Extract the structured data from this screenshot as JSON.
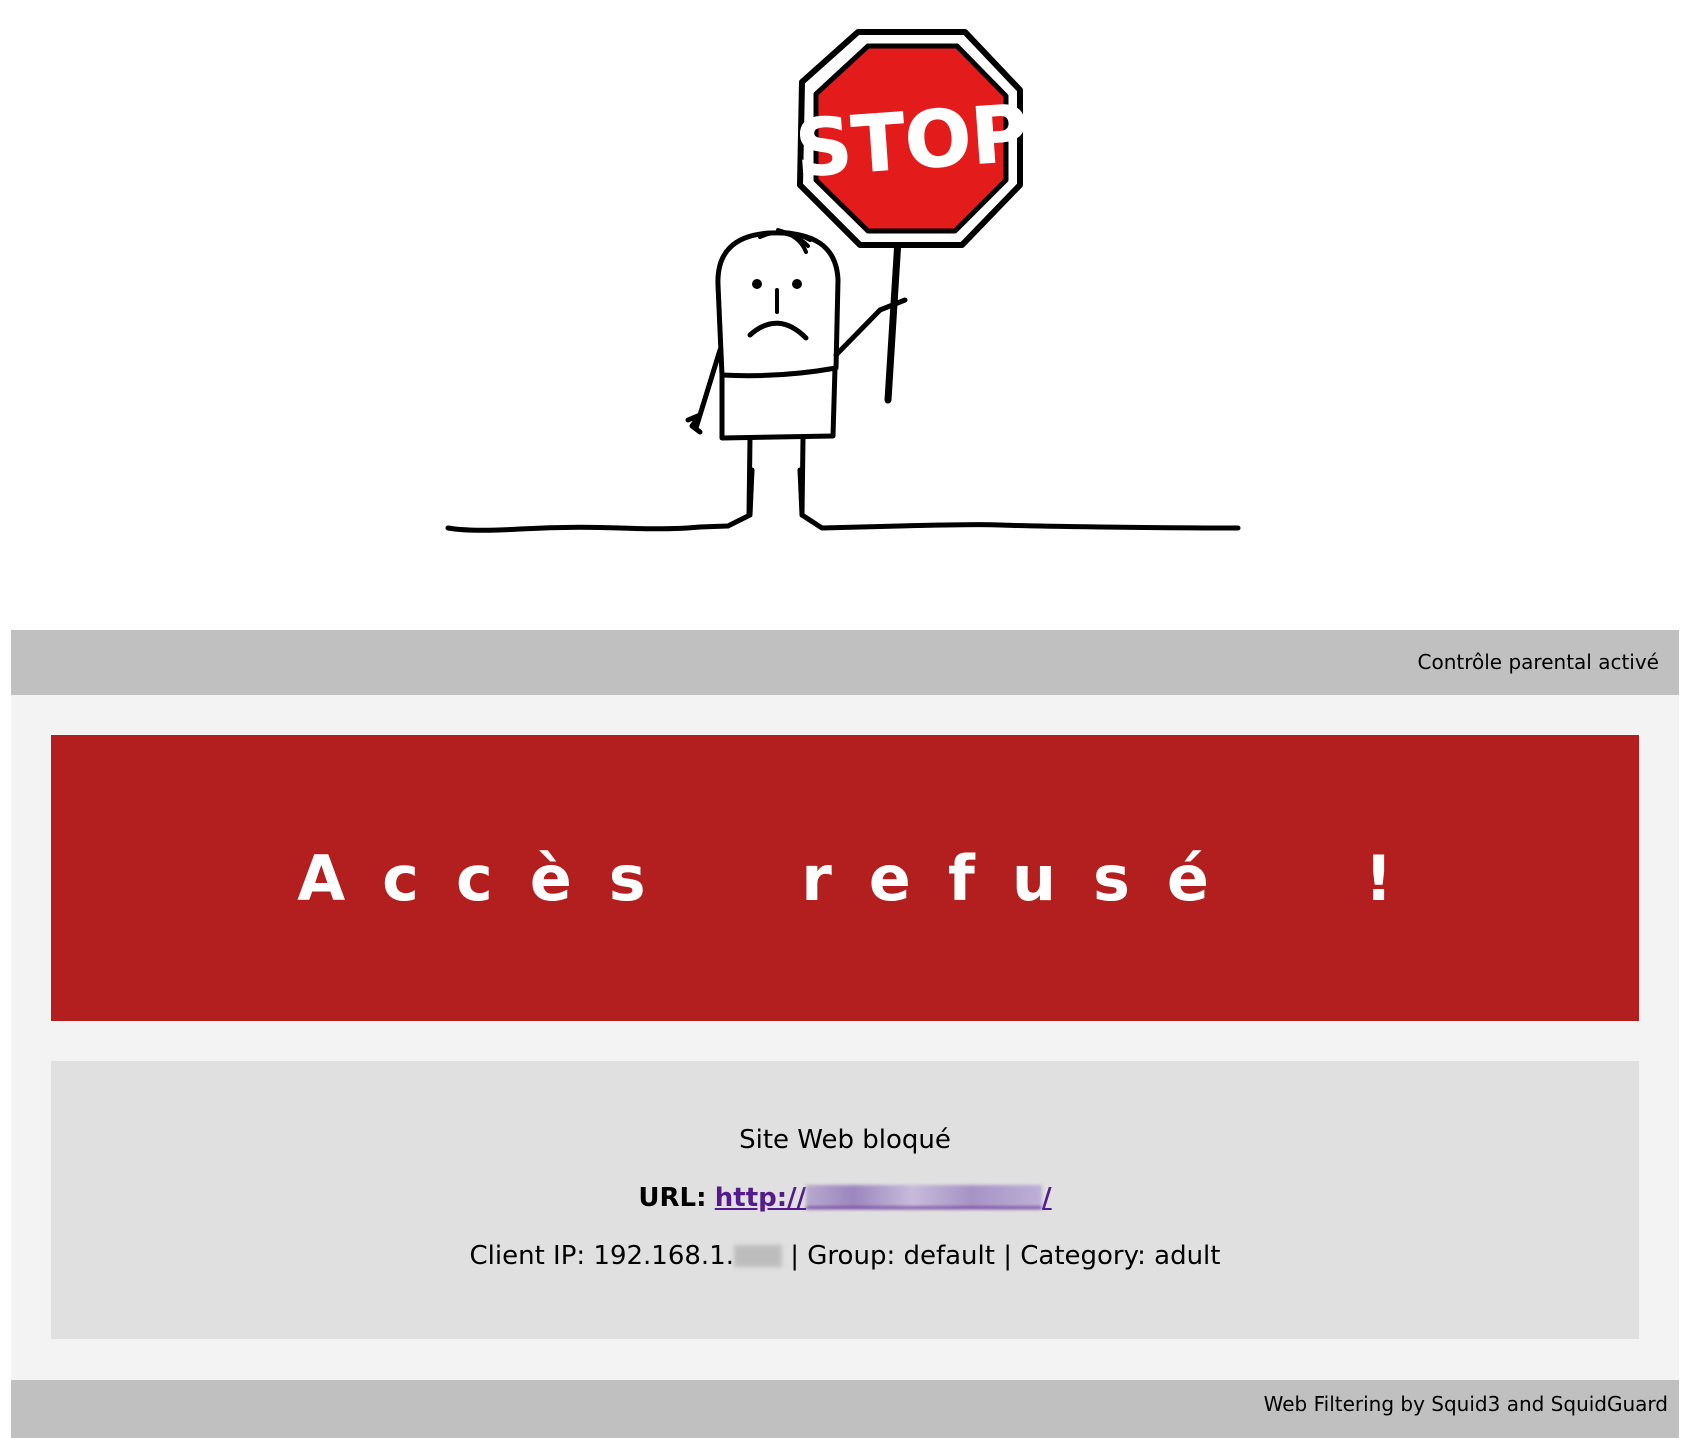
{
  "illustration": {
    "sign_text": "STOP",
    "alt": "stop-sign-figure"
  },
  "header": {
    "status_text": "Contrôle parental activé"
  },
  "banner": {
    "title": "Accès refusé !"
  },
  "info": {
    "heading": "Site Web bloqué",
    "url_label": "URL:",
    "url_prefix": "http://",
    "url_suffix": "/",
    "client_prefix": "Client IP: 192.168.1.",
    "client_suffix": " | Group: default | Category: adult"
  },
  "footer": {
    "credit": "Web Filtering by Squid3 and SquidGuard"
  },
  "colors": {
    "banner_bg": "#b21f1e",
    "bar_bg": "#c0c0c0",
    "panel_bg": "#f3f3f3",
    "info_bg": "#e0e0e0",
    "link": "#551a8b",
    "sign_red": "#e31b1b"
  }
}
